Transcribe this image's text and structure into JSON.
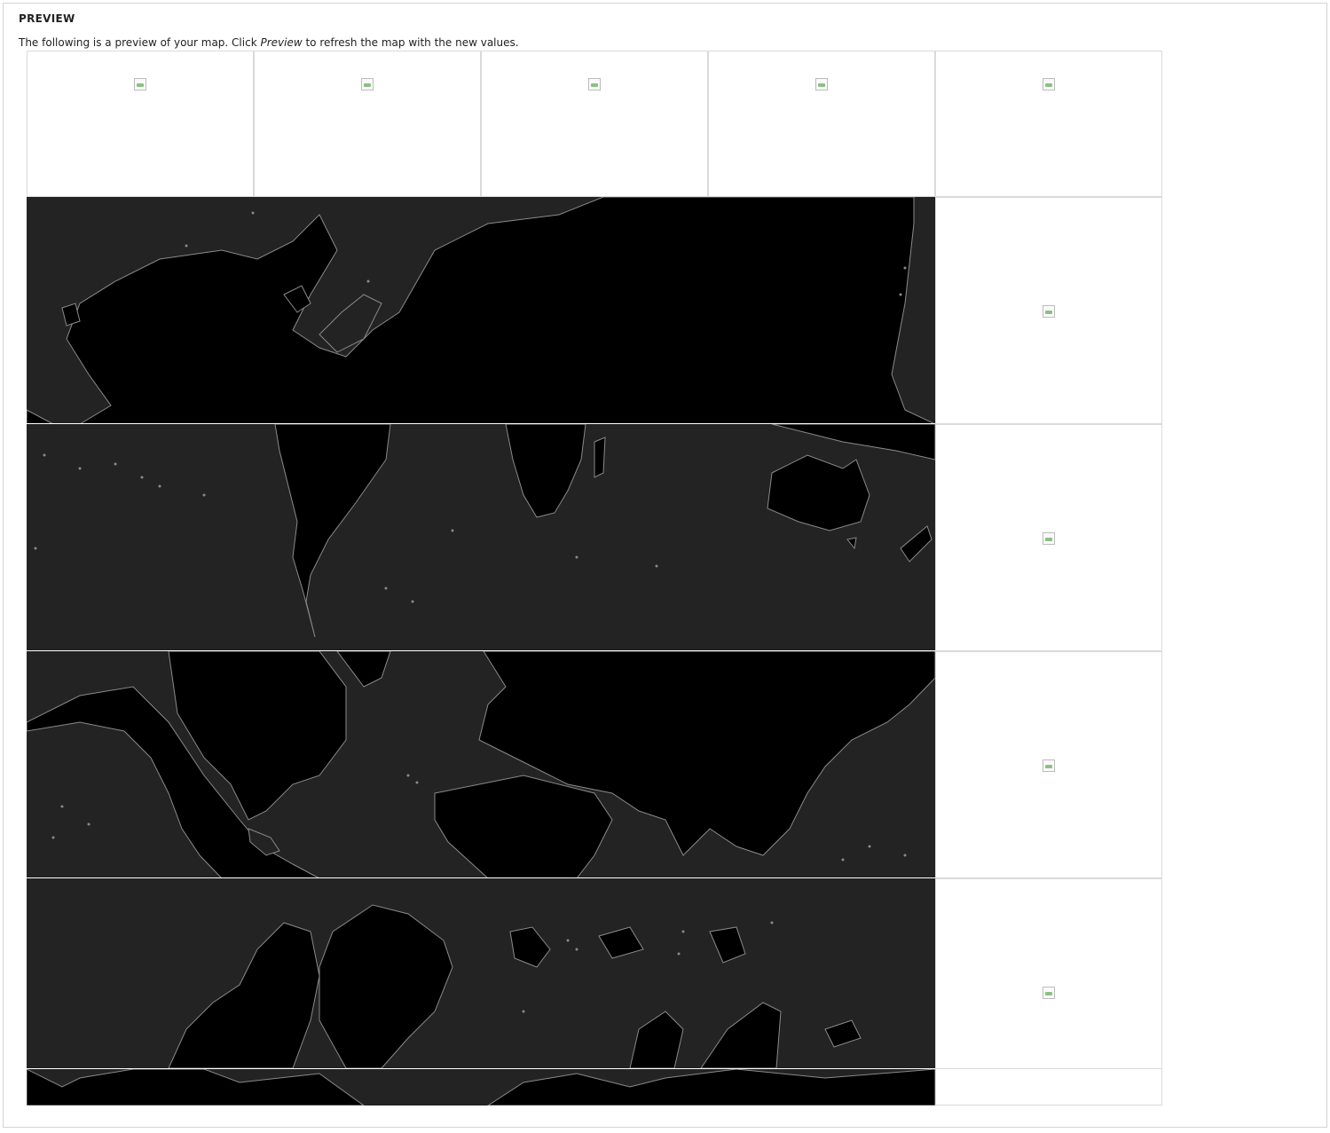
{
  "section": {
    "title": "PREVIEW",
    "description_before": "The following is a preview of your map. Click ",
    "description_link": "Preview",
    "description_after": " to refresh the map with the new values."
  },
  "map": {
    "ocean_color": "#232323",
    "land_color": "#000000",
    "coast_color": "#8a8a8a",
    "tile_border_color": "#dadada",
    "tiles": [
      {
        "name": "broken-tile-top-1",
        "kind": "broken-image-icon"
      },
      {
        "name": "broken-tile-top-2",
        "kind": "broken-image-icon"
      },
      {
        "name": "broken-tile-top-3",
        "kind": "broken-image-icon"
      },
      {
        "name": "broken-tile-top-4",
        "kind": "broken-image-icon"
      },
      {
        "name": "broken-tile-top-5",
        "kind": "broken-image-icon"
      },
      {
        "name": "broken-tile-right-1",
        "kind": "broken-image-icon"
      },
      {
        "name": "broken-tile-right-2",
        "kind": "broken-image-icon"
      },
      {
        "name": "broken-tile-right-3",
        "kind": "broken-image-icon"
      },
      {
        "name": "broken-tile-right-4",
        "kind": "broken-image-icon"
      }
    ]
  }
}
